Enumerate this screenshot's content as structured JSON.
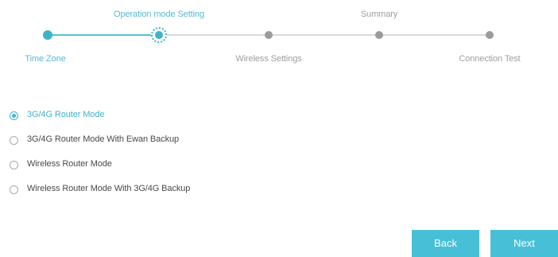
{
  "wizard": {
    "steps": [
      {
        "label": "Time Zone",
        "state": "done"
      },
      {
        "label": "Operation mode Setting",
        "state": "current"
      },
      {
        "label": "Wireless Settings",
        "state": "todo"
      },
      {
        "label": "Summary",
        "state": "todo"
      },
      {
        "label": "Connection Test",
        "state": "todo"
      }
    ],
    "current_step": 2,
    "total_steps": 5
  },
  "options": {
    "items": [
      {
        "label": "3G/4G Router Mode",
        "selected": true
      },
      {
        "label": "3G/4G Router Mode With Ewan Backup",
        "selected": false
      },
      {
        "label": "Wireless Router Mode",
        "selected": false
      },
      {
        "label": "Wireless Router Mode With 3G/4G Backup",
        "selected": false
      }
    ]
  },
  "buttons": {
    "back_label": "Back",
    "next_label": "Next"
  },
  "colors": {
    "accent": "#47bfd7",
    "inactive_step": "#9b9b9b",
    "text": "#4a4a4a"
  }
}
